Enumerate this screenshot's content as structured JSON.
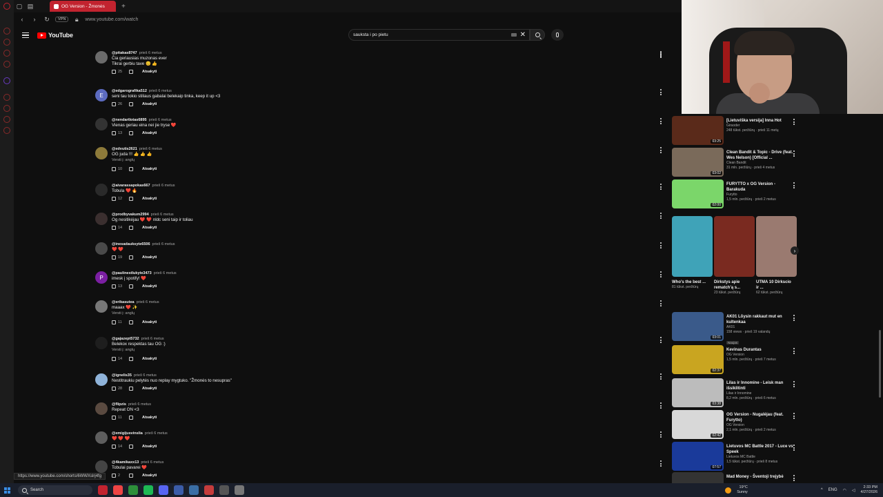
{
  "browser": {
    "tab_title": "OG Version - Žmonės",
    "url": "www.youtube.com/watch",
    "vpn": "VPN",
    "status_url": "https://www.youtube.com/shorts/6WWXslrj4fg"
  },
  "youtube": {
    "logo": "YouTube",
    "search_value": "sauksta i po pietu"
  },
  "comments": [
    {
      "user": "@pitakas8747",
      "time": "prieš 6 metus",
      "lines": [
        "Čia geriausias muzonas ever",
        "Tikrai gerbiu tave 😊 👍"
      ],
      "likes": "25",
      "reply": "Atsakyti",
      "translate": "",
      "avatar": "",
      "avatar_color": "#6b6b6b"
    },
    {
      "user": "@edgarografika512",
      "time": "prieš 6 metus",
      "lines": [
        "seni tau tokio stiliaus gabalai belekaip tinka, keep it up <3"
      ],
      "likes": "26",
      "reply": "Atsakyti",
      "translate": "",
      "avatar": "E",
      "avatar_color": "#5c6bc0"
    },
    {
      "user": "@nendartlotas6895",
      "time": "prieš 6 metus",
      "lines": [
        "Vienas geriau eina nei jie tryse ❤️"
      ],
      "likes": "13",
      "reply": "Atsakyti",
      "translate": "",
      "avatar": "",
      "avatar_color": "#333333"
    },
    {
      "user": "@edvutis2621",
      "time": "prieš 6 metus",
      "lines": [
        "OG juda !!! 👍 👍 👍"
      ],
      "likes": "10",
      "reply": "Atsakyti",
      "translate": "Versti į: anglų",
      "avatar": "",
      "avatar_color": "#8d7a3a"
    },
    {
      "user": "@aivarassapokas667",
      "time": "prieš 6 metus",
      "lines": [
        "Tobula ❤️ 🔥"
      ],
      "likes": "12",
      "reply": "Atsakyti",
      "translate": "",
      "avatar": "",
      "avatar_color": "#2a2a2a"
    },
    {
      "user": "@prodbyvakum2994",
      "time": "prieš 6 metus",
      "lines": [
        "Og nesitikėjau ❤️ ❤️ nldc seni taip ir toliau"
      ],
      "likes": "14",
      "reply": "Atsakyti",
      "translate": "",
      "avatar": "",
      "avatar_color": "#3b2f2f"
    },
    {
      "user": "@inesadauksyte6506",
      "time": "prieš 6 metus",
      "lines": [
        "❤️ ❤️"
      ],
      "likes": "19",
      "reply": "Atsakyti",
      "translate": "",
      "avatar": "",
      "avatar_color": "#4a4a4a"
    },
    {
      "user": "@paulinestlukyte3473",
      "time": "prieš 6 metus",
      "lines": [
        "imesk į spotify! ❤️"
      ],
      "likes": "13",
      "reply": "Atsakyti",
      "translate": "",
      "avatar": "P",
      "avatar_color": "#7b1fa2"
    },
    {
      "user": "@erikasutea",
      "time": "prieš 6 metus",
      "lines": [
        "maaax ❤️ ✨"
      ],
      "likes": "11",
      "reply": "Atsakyti",
      "translate": "Versti į: anglų",
      "avatar": "",
      "avatar_color": "#777777"
    },
    {
      "user": "@gajazept5732",
      "time": "prieš 6 metus",
      "lines": [
        "Belekox respektas tau OG :)"
      ],
      "likes": "14",
      "reply": "Atsakyti",
      "translate": "Versti į: anglų",
      "avatar": "",
      "avatar_color": "#1e1e1e"
    },
    {
      "user": "@ignelis35",
      "time": "prieš 6 metus",
      "lines": [
        "Nestitraukiu pelytės nuo replay mygtuko. \"Žmonės to nesupras\""
      ],
      "likes": "28",
      "reply": "Atsakyti",
      "translate": "",
      "avatar": "",
      "avatar_color": "#8fb3d9"
    },
    {
      "user": "@flipzis",
      "time": "prieš 6 metus",
      "lines": [
        "Repeat ON <3"
      ],
      "likes": "11",
      "reply": "Atsakyti",
      "translate": "",
      "avatar": "",
      "avatar_color": "#5a4a40"
    },
    {
      "user": "@emigijusvinslia",
      "time": "prieš 6 metus",
      "lines": [
        "❤️ ❤️ ❤️"
      ],
      "likes": "14",
      "reply": "Atsakyti",
      "translate": "",
      "avatar": "",
      "avatar_color": "#5e5e5e"
    },
    {
      "user": "@4kamikaxx13",
      "time": "prieš 6 metus",
      "lines": [
        "Tobulai pavarei ❤️"
      ],
      "likes": "2",
      "reply": "Atsakyti",
      "translate": "",
      "avatar": "",
      "avatar_color": "#444444"
    }
  ],
  "side_videos": [
    {
      "title": "[Lietuviška versija] Inna Hot",
      "channel": "Giraoder",
      "meta": "248 tūkst. peržiūrų · prieš 11 metų",
      "duration": "03:25",
      "badge": "",
      "thumb": "#5a2a1a"
    },
    {
      "title": "Clean Bandit & Topic - Drive (feat. Wes Nelson) [Official ...",
      "channel": "Clean Bandit",
      "meta": "31 mln. peržiūrų · prieš 4 metus",
      "duration": "03:02",
      "badge": "",
      "thumb": "#7a6a5a"
    },
    {
      "title": "FURYTTO x OG Version - Barakuda",
      "channel": "Furytto",
      "meta": "1,5 mln. peržiūrų · prieš 2 metus",
      "duration": "02:00",
      "badge": "",
      "thumb": "#7bd66a"
    },
    {
      "title": "AK01 Lõysin rakkaut mut en kultenkaa",
      "channel": "AK01",
      "meta": "158 views · prieš 19 valandų",
      "duration": "03:01",
      "badge": "Naujas",
      "thumb": "#3a5a8a"
    },
    {
      "title": "Kevinas Durantas",
      "channel": "OG Version",
      "meta": "1,5 mln. peržiūrų · prieš 7 metus",
      "duration": "02:37",
      "badge": "",
      "thumb": "#c9a520"
    },
    {
      "title": "Lilas ir Innomine - Leisk man išsiklitinti",
      "channel": "Lilas ir Innomine",
      "meta": "8,2 mln. peržiūrų · prieš 6 metus",
      "duration": "03:38",
      "badge": "",
      "thumb": "#bcbcbc"
    },
    {
      "title": "OG Version - Nugalėjau (feat. Furytto)",
      "channel": "OG Version",
      "meta": "2,1 mln. peržiūrų · prieš 2 metus",
      "duration": "02:42",
      "badge": "",
      "thumb": "#d8d8d8"
    },
    {
      "title": "Lietuvos MC Battle 2017 - Luce vs Speek",
      "channel": "Lietuvos MC Battle",
      "meta": "1,5 tūkst. peržiūrų · prieš 8 metus",
      "duration": "07:57",
      "badge": "",
      "thumb": "#1a3a9a"
    },
    {
      "title": "Mad Money - Šventoji trejybė",
      "channel": "",
      "meta": "",
      "duration": "",
      "badge": "",
      "thumb": "#333333"
    }
  ],
  "shorts": [
    {
      "title": "Who's the best ...",
      "meta": "81 tūkst. peržiūrų",
      "color": "#3fa3b8"
    },
    {
      "title": "Dirkstys apie rematch'ą s...",
      "meta": "23 tūkst. peržiūrų",
      "color": "#7a2a20"
    },
    {
      "title": "UTMA 10 Dirkscio ir ...",
      "meta": "62 tūkst. peržiūrų",
      "color": "#9a7a70"
    }
  ],
  "taskbar": {
    "search": "Search",
    "weather_temp": "19°C",
    "weather_text": "Sunny",
    "lang": "ENG",
    "time": "2:33 PM",
    "date": "4/27/2026"
  }
}
